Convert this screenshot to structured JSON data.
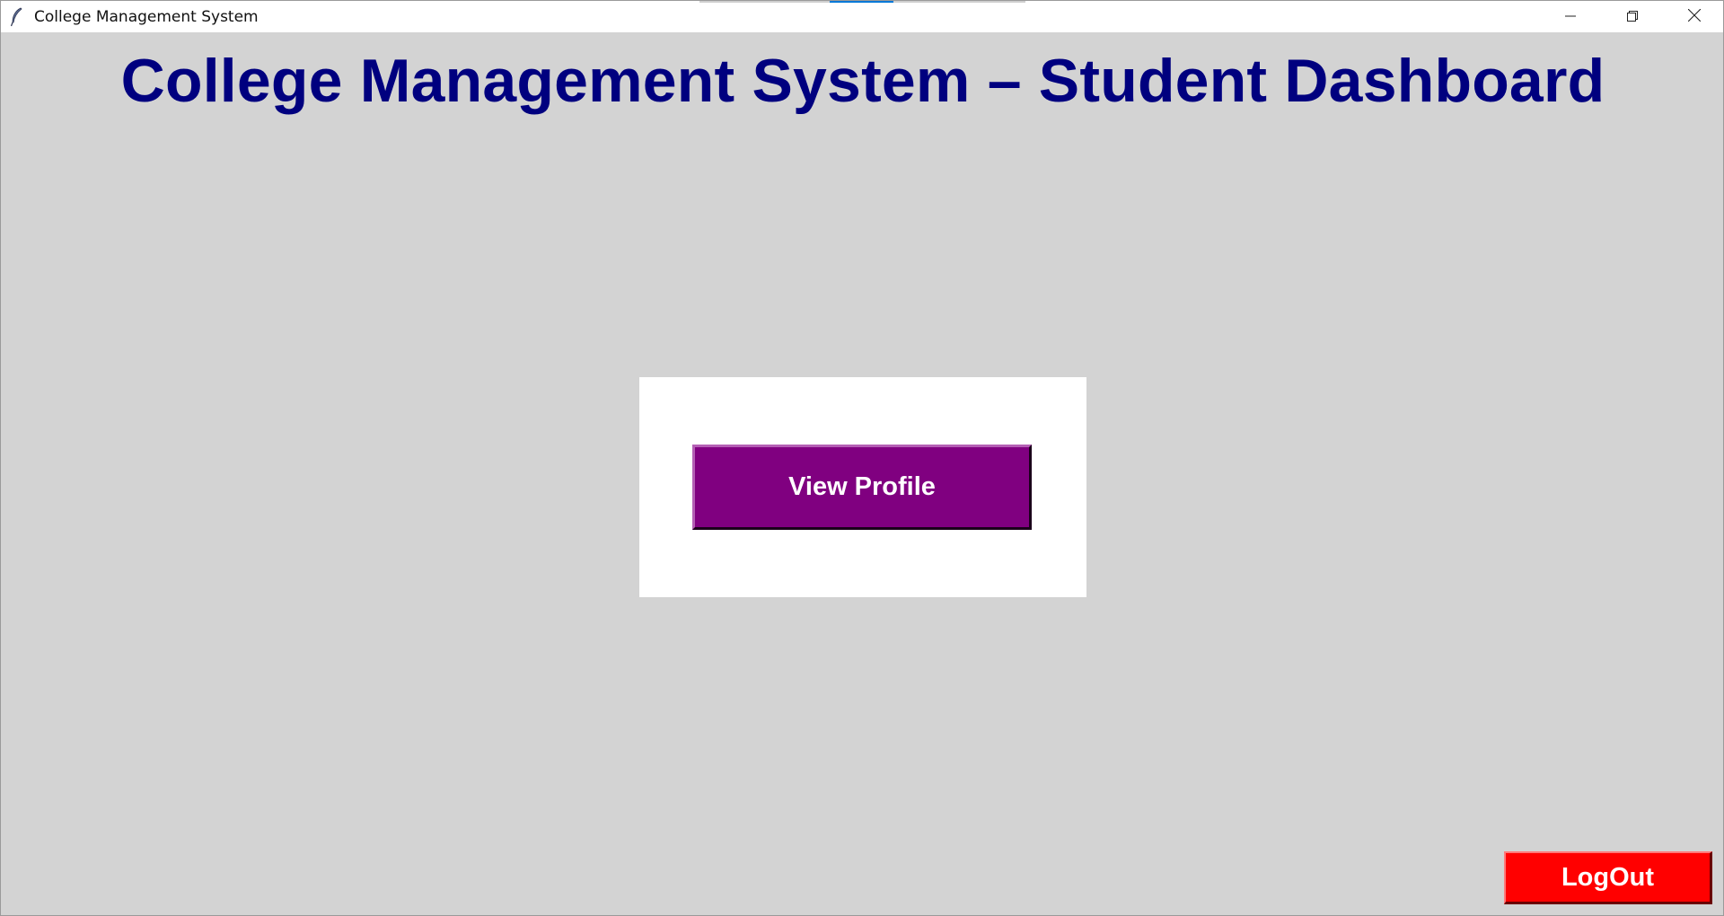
{
  "window": {
    "title": "College Management System",
    "icon": "feather-icon",
    "controls": {
      "minimize_icon": "minimize-icon",
      "restore_icon": "restore-icon",
      "close_icon": "close-icon"
    }
  },
  "header": {
    "title": "College Management System – Student Dashboard",
    "color": "#00007f"
  },
  "dashboard": {
    "background": "#d3d3d3",
    "panel_background": "#ffffff",
    "view_profile_label": "View Profile",
    "view_profile_color": "#800080"
  },
  "footer": {
    "logout_label": "LogOut",
    "logout_color": "#ff0000"
  }
}
